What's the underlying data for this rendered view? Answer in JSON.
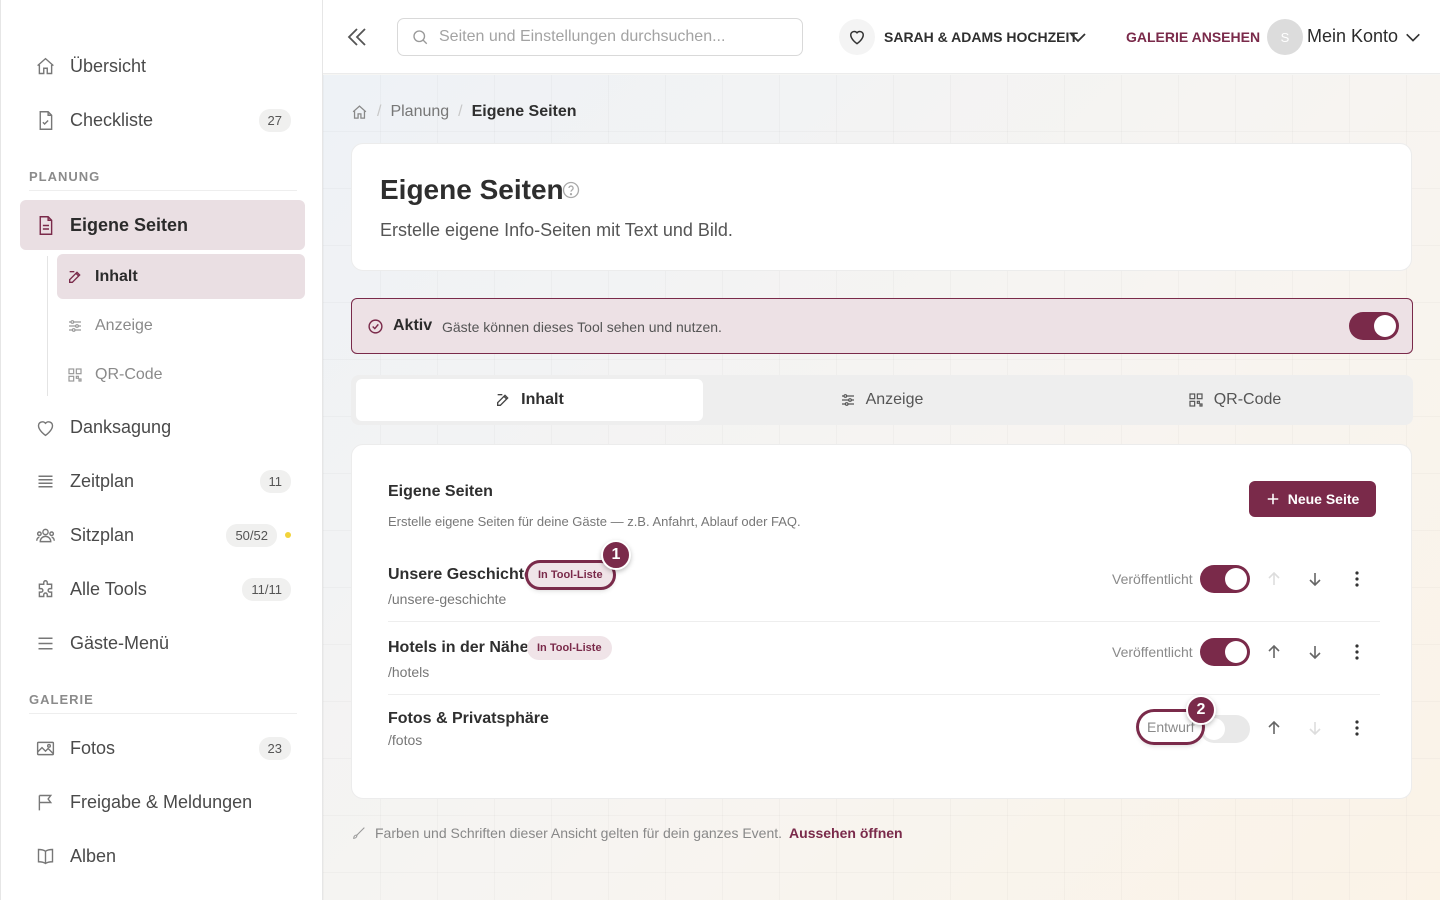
{
  "sidebar": {
    "items": [
      {
        "label": "Übersicht",
        "icon": "home-icon"
      },
      {
        "label": "Checkliste",
        "icon": "checklist-icon",
        "count": "27"
      },
      {
        "label": "Eigene Seiten",
        "icon": "page-icon"
      },
      {
        "label": "Danksagung",
        "icon": "heart-icon"
      },
      {
        "label": "Zeitplan",
        "icon": "timeline-icon",
        "count": "11"
      },
      {
        "label": "Sitzplan",
        "icon": "people-icon",
        "count": "50/52"
      },
      {
        "label": "Alle Tools",
        "icon": "puzzle-icon",
        "count": "11/11"
      },
      {
        "label": "Gäste-Menü",
        "icon": "menu-icon"
      },
      {
        "label": "Fotos",
        "icon": "image-icon",
        "count": "23"
      },
      {
        "label": "Freigabe & Meldungen",
        "icon": "flag-icon"
      },
      {
        "label": "Alben",
        "icon": "book-icon"
      }
    ],
    "sections": {
      "planung": "PLANUNG",
      "galerie": "GALERIE"
    },
    "sub_items": [
      {
        "label": "Inhalt",
        "icon": "edit-icon"
      },
      {
        "label": "Anzeige",
        "icon": "sliders-icon"
      },
      {
        "label": "QR-Code",
        "icon": "qr-icon"
      }
    ]
  },
  "topbar": {
    "search_placeholder": "Seiten und Einstellungen durchsuchen...",
    "event_name": "SARAH & ADAMS HOCHZEIT",
    "gallery_link": "GALERIE ANSEHEN",
    "avatar_initial": "S",
    "account_label": "Mein Konto"
  },
  "breadcrumb": {
    "parent": "Planung",
    "current": "Eigene Seiten"
  },
  "header": {
    "title": "Eigene Seiten",
    "subtitle": "Erstelle eigene Info-Seiten mit Text und Bild."
  },
  "active_bar": {
    "label": "Aktiv",
    "text": "Gäste können dieses Tool sehen und nutzen.",
    "enabled": true
  },
  "tabs": [
    {
      "label": "Inhalt",
      "icon": "edit-icon",
      "active": true
    },
    {
      "label": "Anzeige",
      "icon": "sliders-icon",
      "active": false
    },
    {
      "label": "QR-Code",
      "icon": "qr-icon",
      "active": false
    }
  ],
  "pages_card": {
    "title": "Eigene Seiten",
    "subtitle": "Erstelle eigene Seiten für deine Gäste — z.B. Anfahrt, Ablauf oder FAQ.",
    "new_button": "Neue Seite",
    "rows": [
      {
        "name": "Unsere Geschichte",
        "slug": "/unsere-geschichte",
        "badge": "In Tool-Liste",
        "status": "Veröffentlicht",
        "published": true
      },
      {
        "name": "Hotels in der Nähe",
        "slug": "/hotels",
        "badge": "In Tool-Liste",
        "status": "Veröffentlicht",
        "published": true
      },
      {
        "name": "Fotos & Privatsphäre",
        "slug": "/fotos",
        "badge": "",
        "status": "Entwurf",
        "published": false
      }
    ]
  },
  "markers": [
    "1",
    "2"
  ],
  "footer": {
    "note": "Farben und Schriften dieser Ansicht gelten für dein ganzes Event.",
    "link": "Aussehen öffnen"
  },
  "colors": {
    "accent": "#7a2a4a",
    "accent_soft": "#eadfe3",
    "status_dot": "#f2d33a"
  }
}
